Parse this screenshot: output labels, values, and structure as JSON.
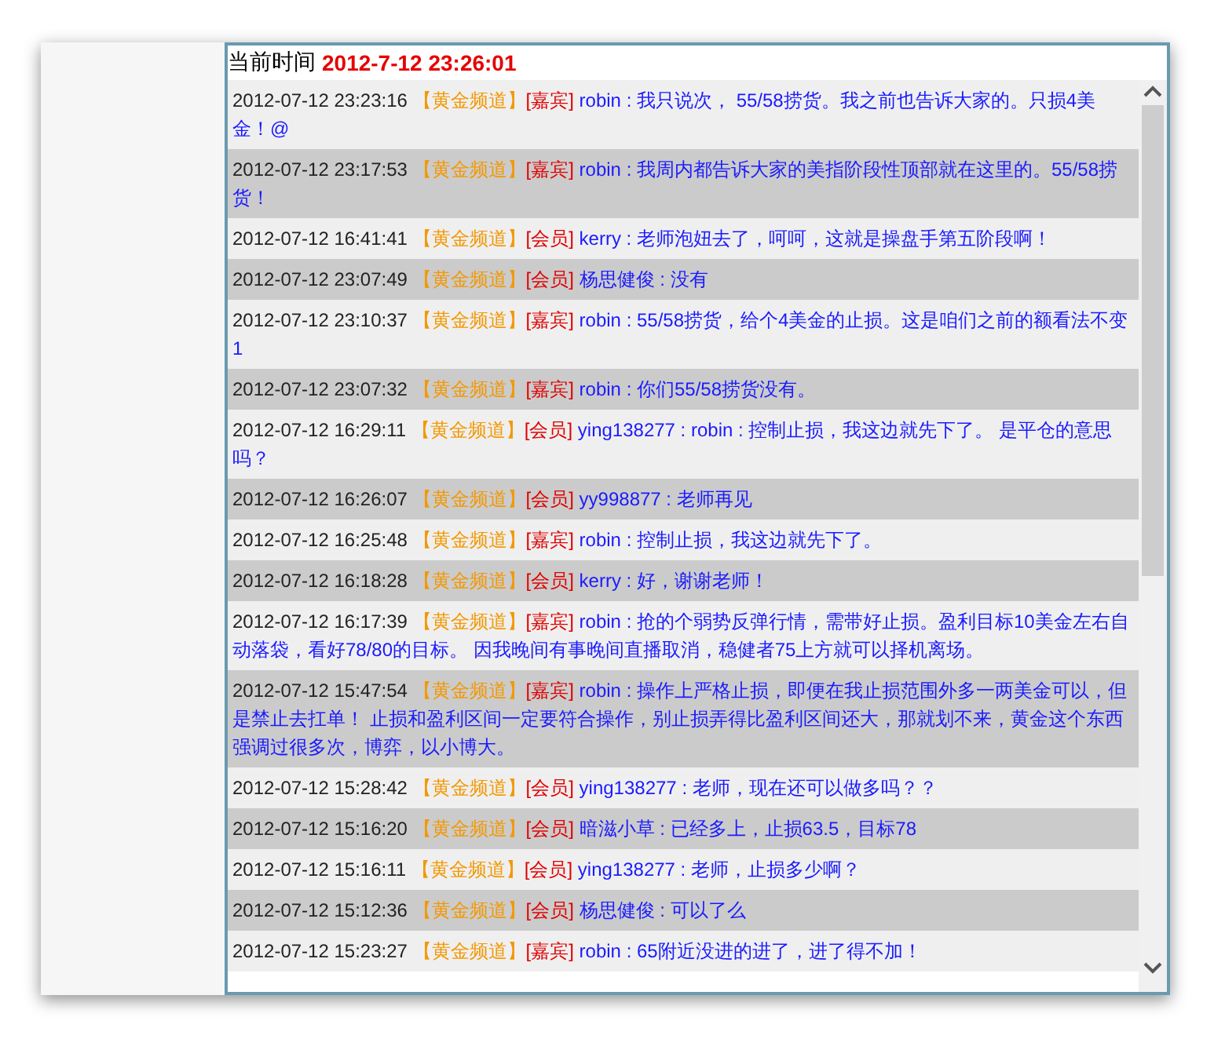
{
  "header": {
    "label": "当前时间",
    "time": "2012-7-12 23:26:01"
  },
  "messages": [
    {
      "time": "2012-07-12 23:23:16",
      "channel": "【黄金频道】",
      "role": "[嘉宾]",
      "user": "robin",
      "text": " : 我只说次， 55/58捞货。我之前也告诉大家的。只损4美金！@"
    },
    {
      "time": "2012-07-12 23:17:53",
      "channel": "【黄金频道】",
      "role": "[嘉宾]",
      "user": "robin",
      "text": " : 我周内都告诉大家的美指阶段性顶部就在这里的。55/58捞货！"
    },
    {
      "time": "2012-07-12 16:41:41",
      "channel": "【黄金频道】",
      "role": "[会员]",
      "user": "kerry",
      "text": " : 老师泡妞去了，呵呵，这就是操盘手第五阶段啊！"
    },
    {
      "time": "2012-07-12 23:07:49",
      "channel": "【黄金频道】",
      "role": "[会员]",
      "user": "杨思健俊",
      "text": " : 没有"
    },
    {
      "time": "2012-07-12 23:10:37",
      "channel": "【黄金频道】",
      "role": "[嘉宾]",
      "user": "robin",
      "text": " : 55/58捞货，给个4美金的止损。这是咱们之前的额看法不变1"
    },
    {
      "time": "2012-07-12 23:07:32",
      "channel": "【黄金频道】",
      "role": "[嘉宾]",
      "user": "robin",
      "text": " : 你们55/58捞货没有。"
    },
    {
      "time": "2012-07-12 16:29:11",
      "channel": "【黄金频道】",
      "role": "[会员]",
      "user": "ying138277",
      "text": " : robin : 控制止损，我这边就先下了。 是平仓的意思吗？"
    },
    {
      "time": "2012-07-12 16:26:07",
      "channel": "【黄金频道】",
      "role": "[会员]",
      "user": "yy998877",
      "text": " : 老师再见"
    },
    {
      "time": "2012-07-12 16:25:48",
      "channel": "【黄金频道】",
      "role": "[嘉宾]",
      "user": "robin",
      "text": " : 控制止损，我这边就先下了。"
    },
    {
      "time": "2012-07-12 16:18:28",
      "channel": "【黄金频道】",
      "role": "[会员]",
      "user": "kerry",
      "text": " : 好，谢谢老师！"
    },
    {
      "time": "2012-07-12 16:17:39",
      "channel": "【黄金频道】",
      "role": "[嘉宾]",
      "user": "robin",
      "text": " : 抢的个弱势反弹行情，需带好止损。盈利目标10美金左右自动落袋，看好78/80的目标。 因我晚间有事晚间直播取消，稳健者75上方就可以择机离场。"
    },
    {
      "time": "2012-07-12 15:47:54",
      "channel": "【黄金频道】",
      "role": "[嘉宾]",
      "user": "robin",
      "text": " : 操作上严格止损，即便在我止损范围外多一两美金可以，但是禁止去扛单！ 止损和盈利区间一定要符合操作，别止损弄得比盈利区间还大，那就划不来，黄金这个东西强调过很多次，博弈，以小博大。"
    },
    {
      "time": "2012-07-12 15:28:42",
      "channel": "【黄金频道】",
      "role": "[会员]",
      "user": "ying138277",
      "text": " : 老师，现在还可以做多吗？？"
    },
    {
      "time": "2012-07-12 15:16:20",
      "channel": "【黄金频道】",
      "role": "[会员]",
      "user": "暗滋小草",
      "text": " : 已经多上，止损63.5，目标78"
    },
    {
      "time": "2012-07-12 15:16:11",
      "channel": "【黄金频道】",
      "role": "[会员]",
      "user": "ying138277",
      "text": " : 老师，止损多少啊？"
    },
    {
      "time": "2012-07-12 15:12:36",
      "channel": "【黄金频道】",
      "role": "[会员]",
      "user": "杨思健俊",
      "text": " : 可以了么"
    },
    {
      "time": "2012-07-12 15:23:27",
      "channel": "【黄金频道】",
      "role": "[嘉宾]",
      "user": "robin",
      "text": " : 65附近没进的进了，进了得不加！"
    }
  ]
}
